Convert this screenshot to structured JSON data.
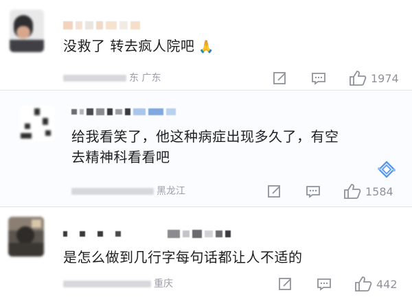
{
  "comments": [
    {
      "text": "没救了 转去疯人院吧",
      "emoji": "🙏",
      "location": "东 广东",
      "likes": "1974"
    },
    {
      "text_line1": "给我看笑了，他这种病症出现多久了，有空",
      "text_line2": "去精神科看看吧",
      "location": "黑龙江",
      "likes": "1584"
    },
    {
      "text": "是怎么做到几行字每句话都让人不适的",
      "location": "重庆",
      "likes": "442"
    }
  ]
}
